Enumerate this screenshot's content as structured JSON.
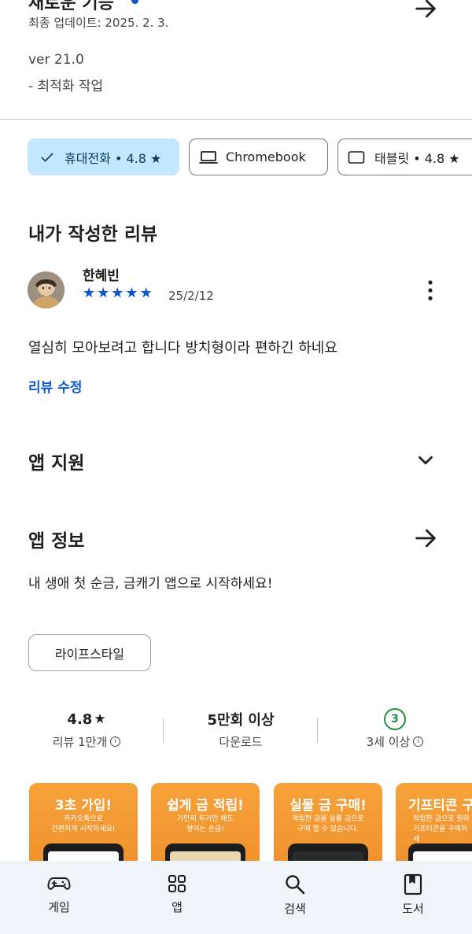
{
  "whats_new": {
    "title": "새로운 기능",
    "updated": "최종 업데이트: 2025. 2. 3.",
    "version": "ver 21.0",
    "note": "- 최적화 작업"
  },
  "device_chips": [
    {
      "label": "휴대전화 • 4.8 ★",
      "selected": true,
      "icon": "check-icon"
    },
    {
      "label": "Chromebook",
      "selected": false,
      "icon": "laptop-icon"
    },
    {
      "label": "태블릿 • 4.8 ★",
      "selected": false,
      "icon": "tablet-icon"
    }
  ],
  "my_review": {
    "heading": "내가 작성한 리뷰",
    "author": "한혜빈",
    "stars": 5,
    "date": "25/2/12",
    "text": "열심히 모아보려고 합니다 방치형이라 편하긴 하네요",
    "edit_label": "리뷰 수정"
  },
  "app_support": {
    "heading": "앱 지원"
  },
  "app_info": {
    "heading": "앱 정보",
    "description": "내 생애 첫 순금, 금캐기 앱으로 시작하세요!",
    "category": "라이프스타일"
  },
  "stats": {
    "rating": "4.8",
    "rating_label": "리뷰 1만개",
    "downloads": "5만회 이상",
    "downloads_label": "다운로드",
    "age_badge": "3",
    "age_label": "3세 이상"
  },
  "screenshots": [
    {
      "title": "3초 가입!",
      "subtitle": "카카오톡으로\n간편하게 시작하세요!"
    },
    {
      "title": "쉽게 금 적립!",
      "subtitle": "가만히 두기만 해도\n쌓이는 순금!"
    },
    {
      "title": "실물 금 구매!",
      "subtitle": "적립한 금을 실물 금으로\n구매 할 수 있습니다."
    },
    {
      "title": "기프티콘 구",
      "subtitle": "적립한 금으로 원하\n기프티콘을 구매하세"
    }
  ],
  "bottom_nav": [
    {
      "label": "게임",
      "icon": "gamepad-icon"
    },
    {
      "label": "앱",
      "icon": "apps-grid-icon"
    },
    {
      "label": "검색",
      "icon": "search-icon"
    },
    {
      "label": "도서",
      "icon": "book-icon"
    }
  ],
  "colors": {
    "accent": "#0b57d0",
    "chip_selected": "#c2e7ff",
    "nav_bg": "#f0f4f9",
    "age_green": "#1e8e3e",
    "screenshot_orange": "#f6a23a"
  }
}
